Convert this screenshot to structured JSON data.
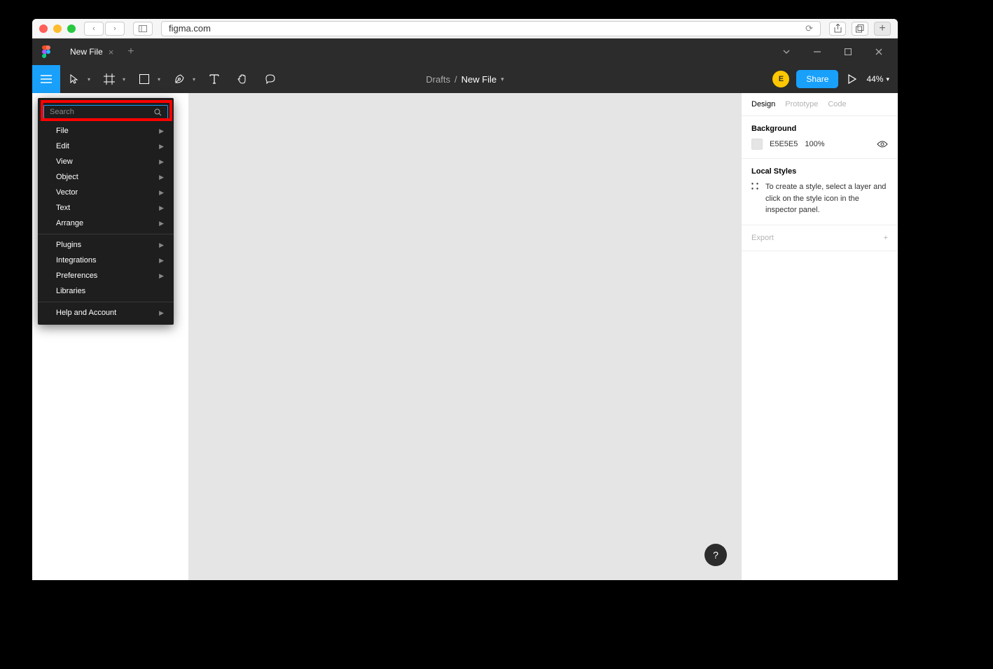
{
  "browser": {
    "url": "figma.com"
  },
  "tab": {
    "title": "New File"
  },
  "breadcrumb": {
    "folder": "Drafts",
    "separator": "/",
    "file": "New File"
  },
  "toolbar": {
    "share_label": "Share",
    "zoom": "44%",
    "avatar_initial": "E"
  },
  "menu": {
    "search_placeholder": "Search",
    "items_1": [
      "File",
      "Edit",
      "View",
      "Object",
      "Vector",
      "Text",
      "Arrange"
    ],
    "items_2": [
      "Plugins",
      "Integrations",
      "Preferences",
      "Libraries"
    ],
    "items_3": [
      "Help and Account"
    ],
    "no_arrow": [
      "Libraries"
    ]
  },
  "right_panel": {
    "tabs": [
      "Design",
      "Prototype",
      "Code"
    ],
    "active_tab": 0,
    "background": {
      "title": "Background",
      "hex": "E5E5E5",
      "opacity": "100%"
    },
    "local_styles": {
      "title": "Local Styles",
      "desc": "To create a style, select a layer and click on the style icon in the inspector panel."
    },
    "export": {
      "title": "Export"
    }
  },
  "help": "?"
}
